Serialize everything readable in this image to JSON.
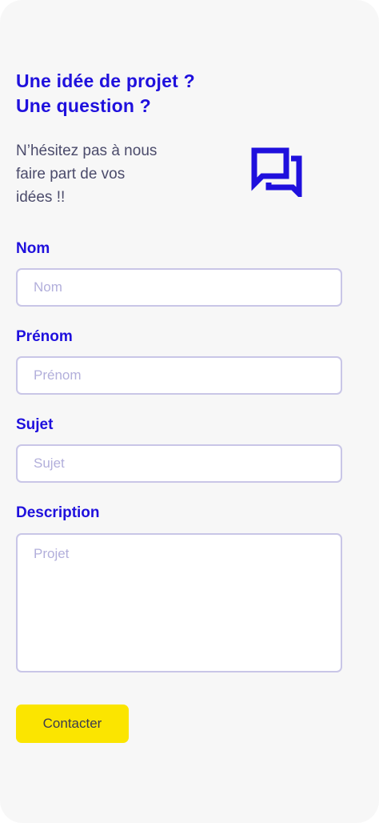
{
  "header": {
    "title_line1": "Une idée de projet ?",
    "title_line2": "Une question ?",
    "intro_line1": "N’hésitez pas à nous",
    "intro_line2": "faire part de vos",
    "intro_line3": "idées !!",
    "icon": "chat-bubbles-icon"
  },
  "form": {
    "nom": {
      "label": "Nom",
      "placeholder": "Nom",
      "value": ""
    },
    "prenom": {
      "label": "Prénom",
      "placeholder": "Prénom",
      "value": ""
    },
    "sujet": {
      "label": "Sujet",
      "placeholder": "Sujet",
      "value": ""
    },
    "description": {
      "label": "Description",
      "placeholder": "Projet",
      "value": ""
    },
    "submit_label": "Contacter"
  },
  "colors": {
    "accent": "#1f10dd",
    "button": "#fbe500",
    "card_background": "#f7f7f7",
    "input_border": "#c9c6e7",
    "placeholder": "#b2afdb"
  }
}
